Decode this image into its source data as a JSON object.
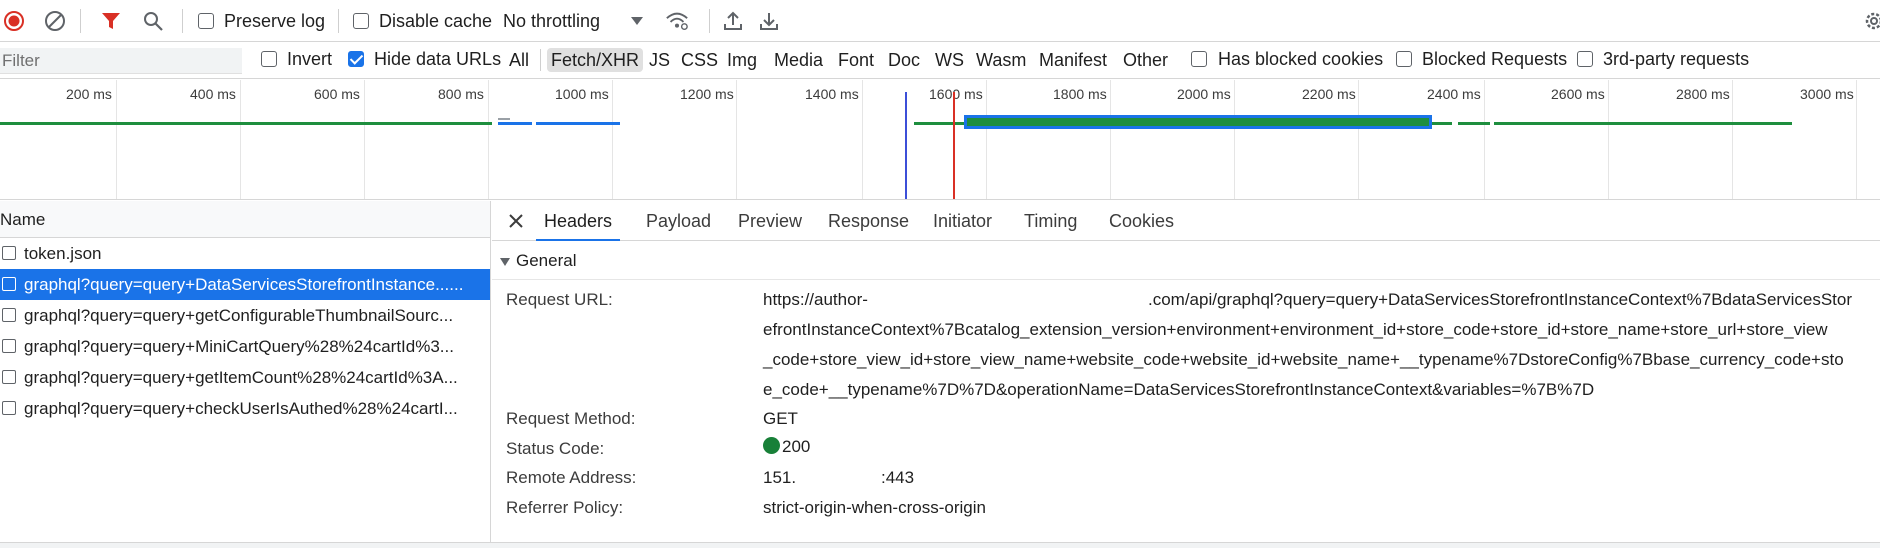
{
  "toolbar": {
    "preserve_log_label": "Preserve log",
    "preserve_log_checked": false,
    "disable_cache_label": "Disable cache",
    "disable_cache_checked": false,
    "throttling_value": "No throttling",
    "colors": {
      "record": "#d93025",
      "filter": "#d93025",
      "accent": "#1a73e8"
    }
  },
  "filter_bar": {
    "filter_placeholder": "Filter",
    "invert_label": "Invert",
    "hide_data_urls_label": "Hide data URLs",
    "types": [
      "All",
      "Fetch/XHR",
      "JS",
      "CSS",
      "Img",
      "Media",
      "Font",
      "Doc",
      "WS",
      "Wasm",
      "Manifest",
      "Other"
    ],
    "active_type": "Fetch/XHR",
    "has_blocked_cookies_label": "Has blocked cookies",
    "blocked_requests_label": "Blocked Requests",
    "third_party_label": "3rd-party requests"
  },
  "timeline": {
    "ticks": [
      "200 ms",
      "400 ms",
      "600 ms",
      "800 ms",
      "1000 ms",
      "1200 ms",
      "1400 ms",
      "1600 ms",
      "1800 ms",
      "2000 ms",
      "2200 ms",
      "2400 ms",
      "2600 ms",
      "2800 ms",
      "3000 ms"
    ]
  },
  "request_list": {
    "header": "Name",
    "rows": [
      "token.json",
      "graphql?query=query+DataServicesStorefrontInstance......",
      "graphql?query=query+getConfigurableThumbnailSourc...",
      "graphql?query=query+MiniCartQuery%28%24cartId%3...",
      "graphql?query=query+getItemCount%28%24cartId%3A...",
      "graphql?query=query+checkUserIsAuthed%28%24cartI..."
    ],
    "selected_index": 1
  },
  "details": {
    "tabs": [
      "Headers",
      "Payload",
      "Preview",
      "Response",
      "Initiator",
      "Timing",
      "Cookies"
    ],
    "active_tab": "Headers",
    "section_title": "General",
    "request_url_key": "Request URL:",
    "request_url_lines": [
      "https://author-",
      "efrontInstanceContext%7Bcatalog_extension_version+environment+environment_id+store_code+store_id+store_name+store_url+store_view",
      "_code+store_view_id+store_view_name+website_code+website_id+website_name+__typename%7DstoreConfig%7Bbase_currency_code+sto",
      "e_code+__typename%7D%7D&operationName=DataServicesStorefrontInstanceContext&variables=%7B%7D"
    ],
    "request_url_line1_tail": ".com/api/graphql?query=query+DataServicesStorefrontInstanceContext%7BdataServicesStor",
    "request_method_key": "Request Method:",
    "request_method_value": "GET",
    "status_code_key": "Status Code:",
    "status_code_value": "200",
    "remote_address_key": "Remote Address:",
    "remote_address_prefix": "151.",
    "remote_address_port": ":443",
    "referrer_policy_key": "Referrer Policy:",
    "referrer_policy_value": "strict-origin-when-cross-origin"
  }
}
